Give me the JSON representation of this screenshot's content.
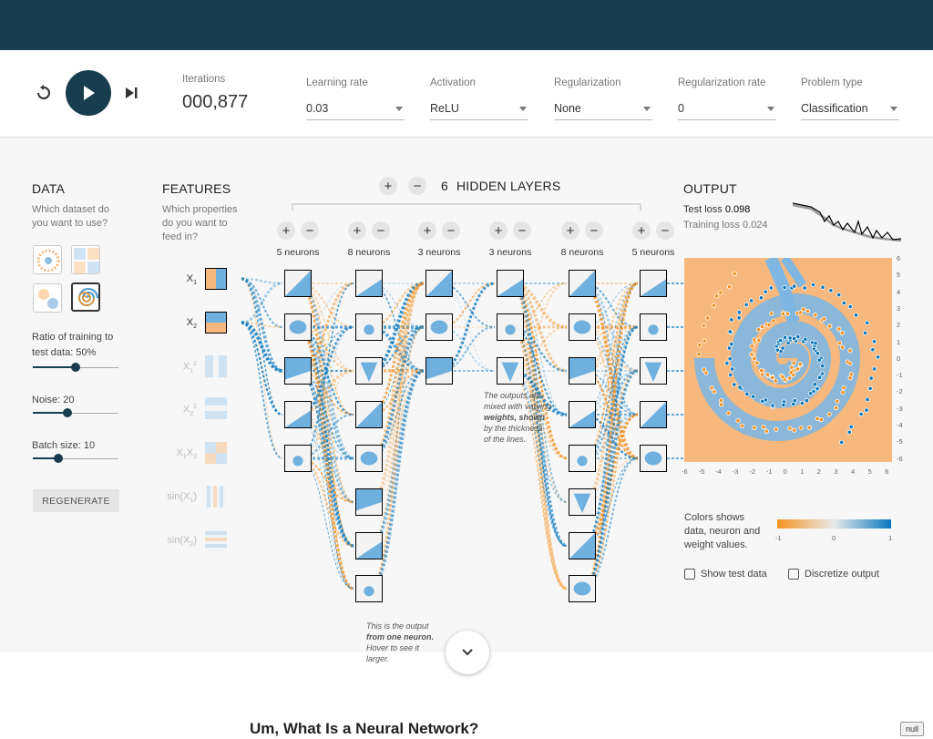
{
  "controls": {
    "iterations_label": "Iterations",
    "iterations_value": "000,877",
    "learning_rate": {
      "label": "Learning rate",
      "value": "0.03"
    },
    "activation": {
      "label": "Activation",
      "value": "ReLU"
    },
    "regularization": {
      "label": "Regularization",
      "value": "None"
    },
    "regularization_rate": {
      "label": "Regularization rate",
      "value": "0"
    },
    "problem_type": {
      "label": "Problem type",
      "value": "Classification"
    }
  },
  "data": {
    "heading": "DATA",
    "question_1": "Which dataset do",
    "question_2": "you want to use?",
    "ratio_label_1": "Ratio of training to",
    "ratio_label_2": "test data:  50%",
    "ratio_value": 0.5,
    "noise_label": "Noise:  20",
    "noise_value": 0.4,
    "batch_label": "Batch size:  10",
    "batch_value": 0.3,
    "regenerate": "REGENERATE"
  },
  "features": {
    "heading": "FEATURES",
    "question_1": "Which properties",
    "question_2": "do you want to",
    "question_3": "feed in?"
  },
  "network": {
    "layer_count": "6",
    "heading": "HIDDEN LAYERS",
    "plus": "+",
    "minus": "−",
    "layer_1_neurons": "5 neurons",
    "layer_2_neurons": "8 neurons",
    "layer_3_neurons": "3 neurons",
    "layer_4_neurons": "3 neurons",
    "layer_5_neurons": "8 neurons",
    "layer_6_neurons": "5 neurons",
    "note_weights_1": "The outputs are",
    "note_weights_2": "mixed with varying",
    "note_weights_3": "weights, shown",
    "note_weights_4": "by the thickness",
    "note_weights_5": "of the lines.",
    "note_neuron_1": "This is the output",
    "note_neuron_2": "from one neuron.",
    "note_neuron_3": "Hover to see it",
    "note_neuron_4": "larger."
  },
  "output": {
    "heading": "OUTPUT",
    "test_loss_label": "Test loss",
    "test_loss_value": "0.098",
    "training_loss_label": "Training loss",
    "training_loss_value": "0.024",
    "colors_1": "Colors shows",
    "colors_2": "data, neuron and",
    "colors_3": "weight values.",
    "scale_min": "-1",
    "scale_mid": "0",
    "scale_max": "1",
    "show_test_data": "Show test data",
    "discretize_output": "Discretize output",
    "x_ticks": [
      "-6",
      "-5",
      "-4",
      "-3",
      "-2",
      "-1",
      "0",
      "1",
      "2",
      "3",
      "4",
      "5",
      "6"
    ],
    "y_ticks": [
      "6",
      "5",
      "4",
      "3",
      "2",
      "1",
      "0",
      "-1",
      "-2",
      "-3",
      "-4",
      "-5",
      "-6"
    ]
  },
  "colors": {
    "orange": "#f59322",
    "blue": "#0877bd",
    "dark": "#183d4e"
  },
  "article_title": "Um, What Is a Neural Network?",
  "null_button": "null"
}
